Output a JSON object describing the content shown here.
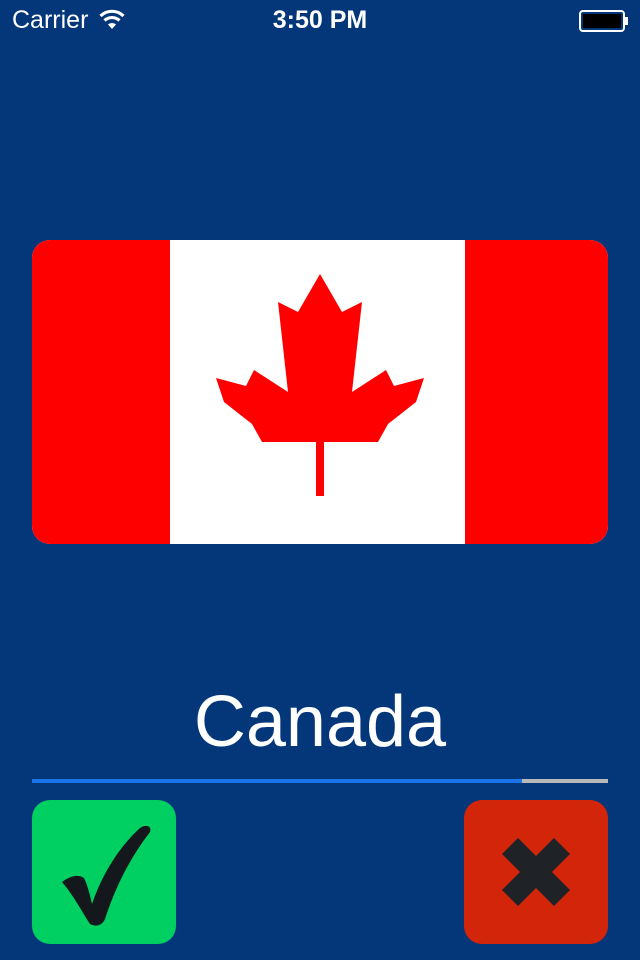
{
  "status_bar": {
    "carrier": "Carrier",
    "time": "3:50 PM",
    "wifi_icon": "wifi-icon",
    "battery_icon": "battery-icon"
  },
  "flag": {
    "icon": "canada-flag",
    "colors": {
      "red": "#ff0000",
      "white": "#ffffff"
    }
  },
  "country": {
    "name": "Canada"
  },
  "progress": {
    "fraction": 0.851
  },
  "buttons": {
    "correct": {
      "icon": "checkmark-icon",
      "color": "#00cf62"
    },
    "wrong": {
      "icon": "x-icon",
      "color": "#d2250a"
    }
  },
  "colors": {
    "background": "#03377a",
    "progress_fill": "#1a73e8",
    "progress_track": "#b8b8b8"
  }
}
